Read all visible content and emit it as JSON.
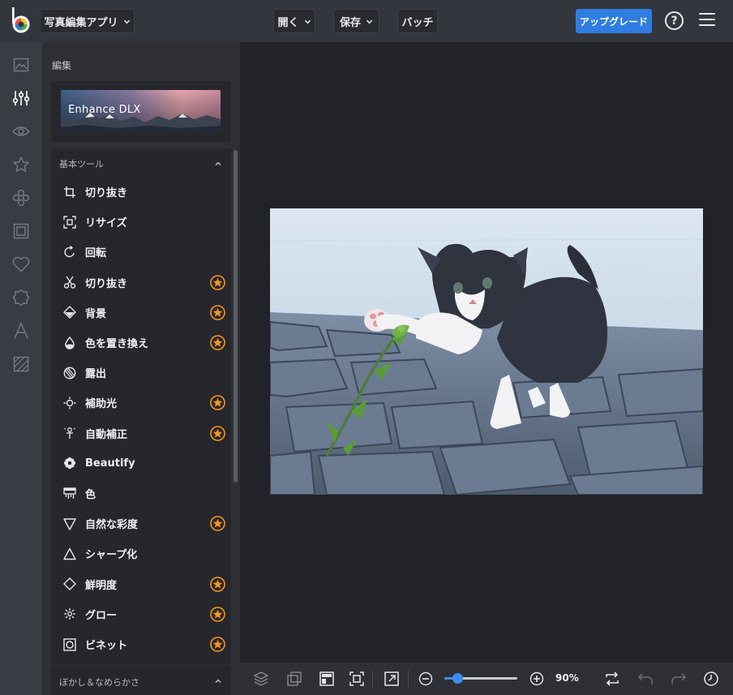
{
  "app": {
    "title": "写真編集アプリ",
    "open": "開く",
    "save": "保存",
    "batch": "バッチ",
    "upgrade": "アップグレード",
    "help": "?"
  },
  "rail": {
    "icons": [
      "image-icon",
      "sliders-icon",
      "eye-icon",
      "star-icon",
      "circles-icon",
      "frame-icon",
      "heart-icon",
      "badge-icon",
      "text-icon",
      "texture-icon"
    ]
  },
  "panel": {
    "title": "編集",
    "enhance_label": "Enhance DLX",
    "section1": "基本ツール",
    "section2": "ぼかし＆なめらかさ",
    "tools": [
      {
        "label": "切り抜き",
        "icon": "crop-icon",
        "premium": false
      },
      {
        "label": "リサイズ",
        "icon": "resize-icon",
        "premium": false
      },
      {
        "label": "回転",
        "icon": "rotate-icon",
        "premium": false
      },
      {
        "label": "切り抜き",
        "icon": "scissors-icon",
        "premium": true
      },
      {
        "label": "背景",
        "icon": "background-icon",
        "premium": true
      },
      {
        "label": "色を置き換え",
        "icon": "droplet-icon",
        "premium": true
      },
      {
        "label": "露出",
        "icon": "exposure-icon",
        "premium": false
      },
      {
        "label": "補助光",
        "icon": "fill-light-icon",
        "premium": true
      },
      {
        "label": "自動補正",
        "icon": "auto-fix-icon",
        "premium": true
      },
      {
        "label": "Beautify",
        "icon": "flower-icon",
        "premium": false
      },
      {
        "label": "色",
        "icon": "color-icon",
        "premium": false
      },
      {
        "label": "自然な彩度",
        "icon": "vibrance-icon",
        "premium": true
      },
      {
        "label": "シャープ化",
        "icon": "sharpen-icon",
        "premium": false
      },
      {
        "label": "鮮明度",
        "icon": "clarity-icon",
        "premium": true
      },
      {
        "label": "グロー",
        "icon": "glow-icon",
        "premium": true
      },
      {
        "label": "ビネット",
        "icon": "vignette-icon",
        "premium": true
      }
    ]
  },
  "bottom": {
    "zoom_text": "90%",
    "zoom_value": 0.9,
    "icons": [
      "layers-icon",
      "compare-icon",
      "split-view-icon",
      "fit-screen-icon",
      "open-external-icon",
      "zoom-out-icon",
      "zoom-in-icon",
      "swap-icon",
      "undo-icon",
      "redo-icon",
      "history-icon"
    ]
  },
  "colors": {
    "accent": "#2f7de1",
    "star": "#f7941d",
    "topbar": "#34363d",
    "panel": "#2e3036"
  }
}
